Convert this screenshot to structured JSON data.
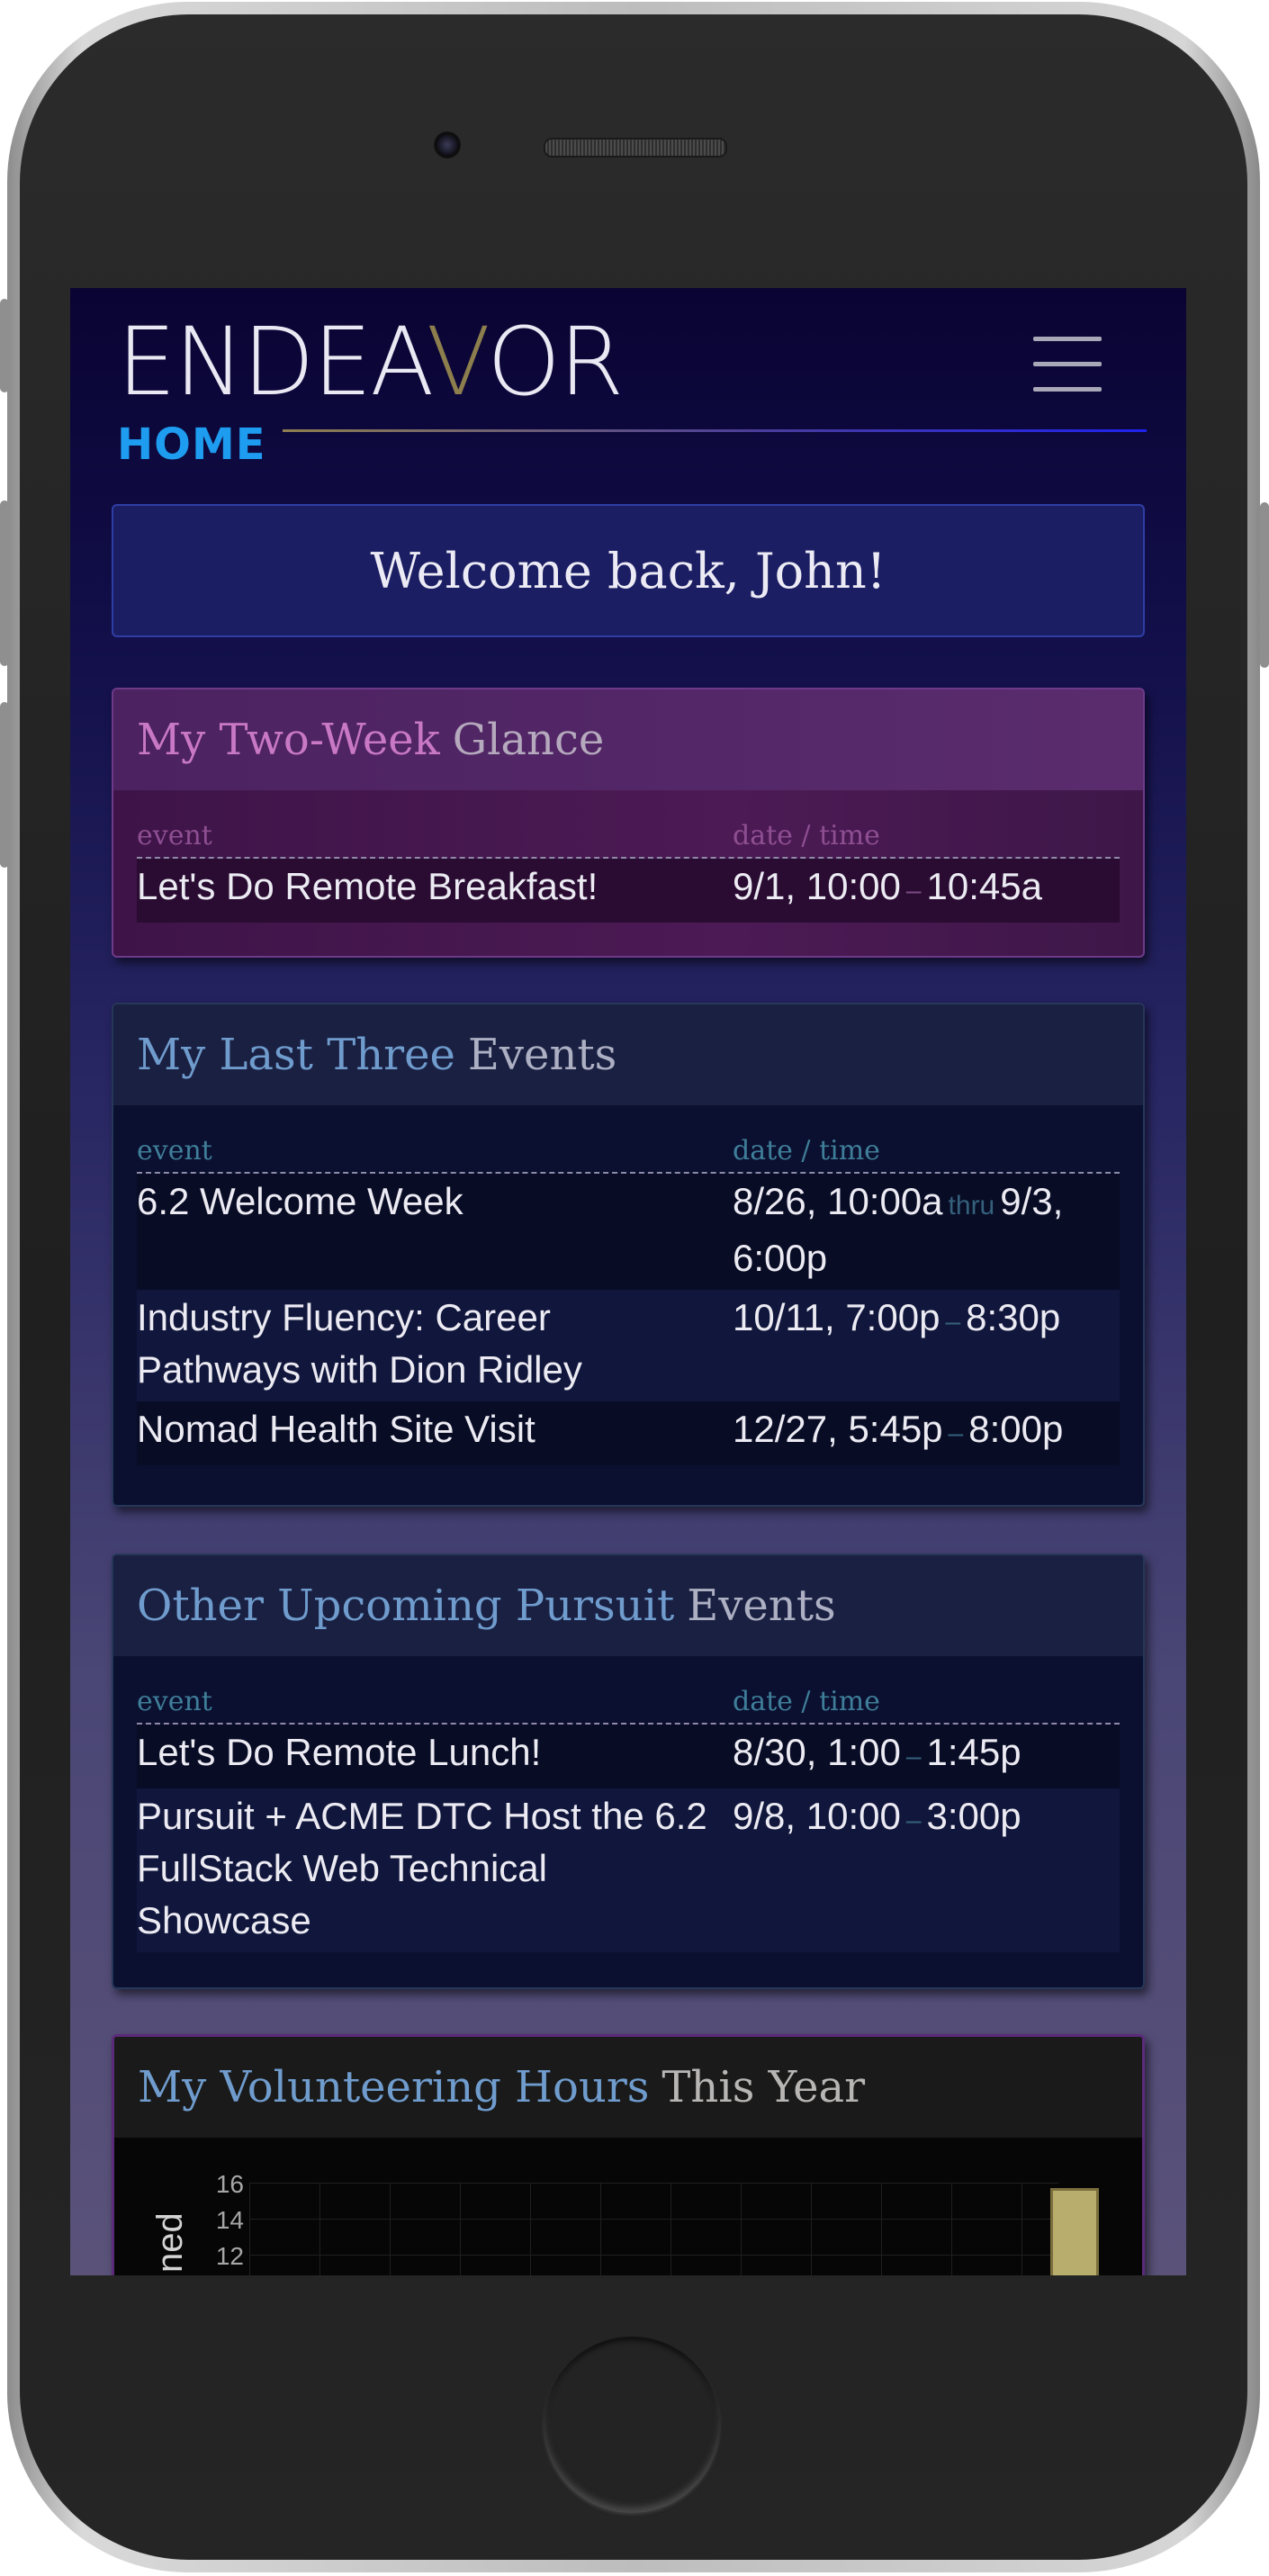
{
  "header": {
    "brand_pre": "ENDEA",
    "brand_v": "V",
    "brand_post": "OR",
    "page_label": "HOME",
    "menu_icon": "hamburger-menu-icon"
  },
  "welcome": {
    "text": "Welcome back, John!"
  },
  "glance": {
    "title_lead": "My Two-Week",
    "title_rest": "Glance",
    "col_event": "event",
    "col_date": "date / time",
    "rows": [
      {
        "event": "Let's Do Remote Breakfast!",
        "start": "9/1, 10:00",
        "sep": "–",
        "end": "10:45a"
      }
    ]
  },
  "last_three": {
    "title_lead": "My Last Three",
    "title_rest": "Events",
    "col_event": "event",
    "col_date": "date / time",
    "rows": [
      {
        "event": "6.2 Welcome Week",
        "start": "8/26, 10:00a",
        "sep": "thru",
        "end": "9/3, 6:00p"
      },
      {
        "event": "Industry Fluency: Career Pathways with Dion Ridley",
        "start": "10/11, 7:00p",
        "sep": "–",
        "end": "8:30p"
      },
      {
        "event": "Nomad Health Site Visit",
        "start": "12/27, 5:45p",
        "sep": "–",
        "end": "8:00p"
      }
    ]
  },
  "other_upcoming": {
    "title_lead": "Other Upcoming Pursuit",
    "title_rest": "Events",
    "col_event": "event",
    "col_date": "date / time",
    "rows": [
      {
        "event": "Let's Do Remote Lunch!",
        "start": "8/30, 1:00",
        "sep": "–",
        "end": "1:45p"
      },
      {
        "event": "Pursuit + ACME DTC Host the 6.2 FullStack Web Technical Showcase",
        "start": "9/8, 10:00",
        "sep": "–",
        "end": "3:00p"
      }
    ]
  },
  "volunteering": {
    "title_lead": "My Volunteering Hours",
    "title_rest": "This Year",
    "y_axis_label_visible": "ned",
    "y_ticks": [
      "16",
      "14",
      "12"
    ]
  },
  "colors": {
    "accent_blue": "#1d9cf0",
    "brand_gold": "#8d7e4d",
    "glance_purple": "#c978c6",
    "title_blue": "#6f9ccd"
  }
}
